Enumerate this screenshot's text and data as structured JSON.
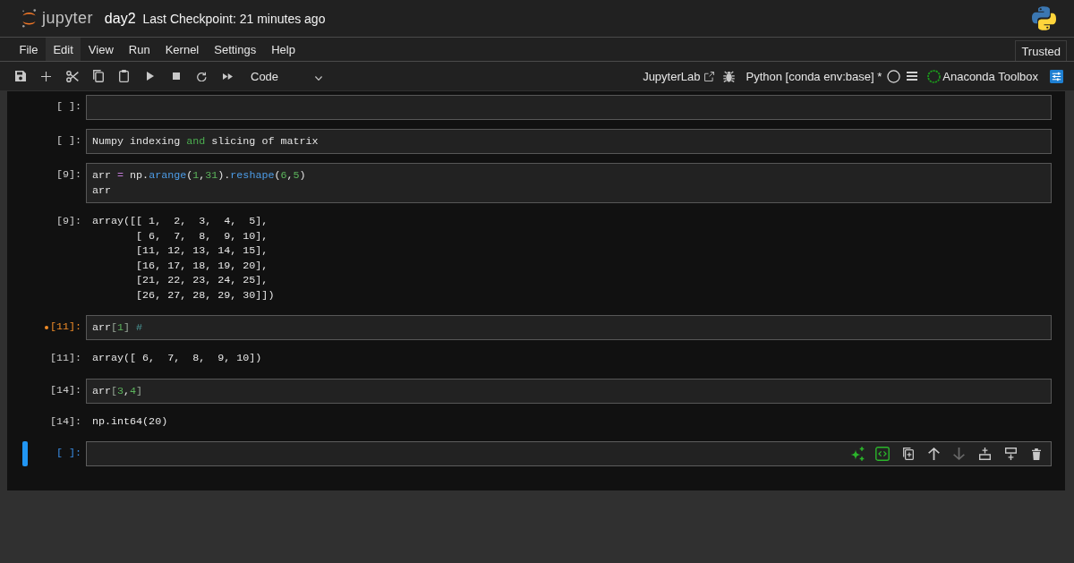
{
  "header": {
    "logo_text": "jupyter",
    "notebook_name": "day2",
    "checkpoint": "Last Checkpoint: 21 minutes ago"
  },
  "menu": [
    {
      "label": "File",
      "selected": false
    },
    {
      "label": "Edit",
      "selected": true
    },
    {
      "label": "View",
      "selected": false
    },
    {
      "label": "Run",
      "selected": false
    },
    {
      "label": "Kernel",
      "selected": false
    },
    {
      "label": "Settings",
      "selected": false
    },
    {
      "label": "Help",
      "selected": false
    }
  ],
  "trusted": "Trusted",
  "toolbar": {
    "cell_type": "Code",
    "link": "JupyterLab",
    "kernel": {
      "name": "Python [conda env:base] *",
      "busy": false
    },
    "extension": "Anaconda Toolbox"
  },
  "cells": [
    {
      "prompt": "[ ]:",
      "selected": false,
      "dirty": false
    },
    {
      "prompt": "[ ]:",
      "selected": false,
      "dirty": false,
      "lines": [
        [
          {
            "text": "Numpy indexing ",
            "kind": "name"
          },
          {
            "text": "and",
            "kind": "keyword"
          },
          {
            "text": " slicing of matrix",
            "kind": "name"
          }
        ]
      ]
    },
    {
      "prompt": "[9]:",
      "selected": false,
      "dirty": false,
      "lines": [
        [
          {
            "text": "arr ",
            "kind": "name"
          },
          {
            "text": "=",
            "kind": "operator"
          },
          {
            "text": " np.",
            "kind": "name"
          },
          {
            "text": "arange",
            "kind": "function"
          },
          {
            "text": "(",
            "kind": "punct"
          },
          {
            "text": "1",
            "kind": "number"
          },
          {
            "text": ",",
            "kind": "punct"
          },
          {
            "text": "31",
            "kind": "number"
          },
          {
            "text": ").",
            "kind": "punct"
          },
          {
            "text": "reshape",
            "kind": "function"
          },
          {
            "text": "(",
            "kind": "punct"
          },
          {
            "text": "6",
            "kind": "number"
          },
          {
            "text": ",",
            "kind": "punct"
          },
          {
            "text": "5",
            "kind": "number"
          },
          {
            "text": ")",
            "kind": "punct"
          }
        ],
        [
          {
            "text": "arr",
            "kind": "name"
          }
        ]
      ],
      "output": {
        "prompt": "[9]:",
        "lines": [
          "array([[ 1,  2,  3,  4,  5],",
          "       [ 6,  7,  8,  9, 10],",
          "       [11, 12, 13, 14, 15],",
          "       [16, 17, 18, 19, 20],",
          "       [21, 22, 23, 24, 25],",
          "       [26, 27, 28, 29, 30]])"
        ]
      }
    },
    {
      "prompt": "[11]:",
      "selected": false,
      "dirty": true,
      "lines": [
        [
          {
            "text": "arr",
            "kind": "name"
          },
          {
            "text": "[",
            "kind": "bracket"
          },
          {
            "text": "1",
            "kind": "number"
          },
          {
            "text": "]",
            "kind": "bracket"
          },
          {
            "text": " #",
            "kind": "comment"
          }
        ]
      ],
      "output": {
        "prompt": "[11]:",
        "lines": [
          "array([ 6,  7,  8,  9, 10])"
        ]
      }
    },
    {
      "prompt": "[14]:",
      "selected": false,
      "dirty": false,
      "lines": [
        [
          {
            "text": "arr",
            "kind": "name"
          },
          {
            "text": "[",
            "kind": "bracket"
          },
          {
            "text": "3",
            "kind": "number"
          },
          {
            "text": ",",
            "kind": "punct"
          },
          {
            "text": "4",
            "kind": "number"
          },
          {
            "text": "]",
            "kind": "bracket"
          }
        ]
      ],
      "output": {
        "prompt": "[14]:",
        "lines": [
          "np.int64(20)"
        ]
      }
    },
    {
      "prompt": "[ ]:",
      "selected": true,
      "dirty": false,
      "toolbar": [
        {
          "kind": "generate",
          "disabled": false
        },
        {
          "kind": "code",
          "disabled": false
        },
        {
          "kind": "duplicate",
          "disabled": false
        },
        {
          "kind": "move_up",
          "disabled": false
        },
        {
          "kind": "move_down",
          "disabled": true
        },
        {
          "kind": "insert_above",
          "disabled": false
        },
        {
          "kind": "insert_below",
          "disabled": false
        },
        {
          "kind": "delete",
          "disabled": false
        }
      ]
    }
  ]
}
